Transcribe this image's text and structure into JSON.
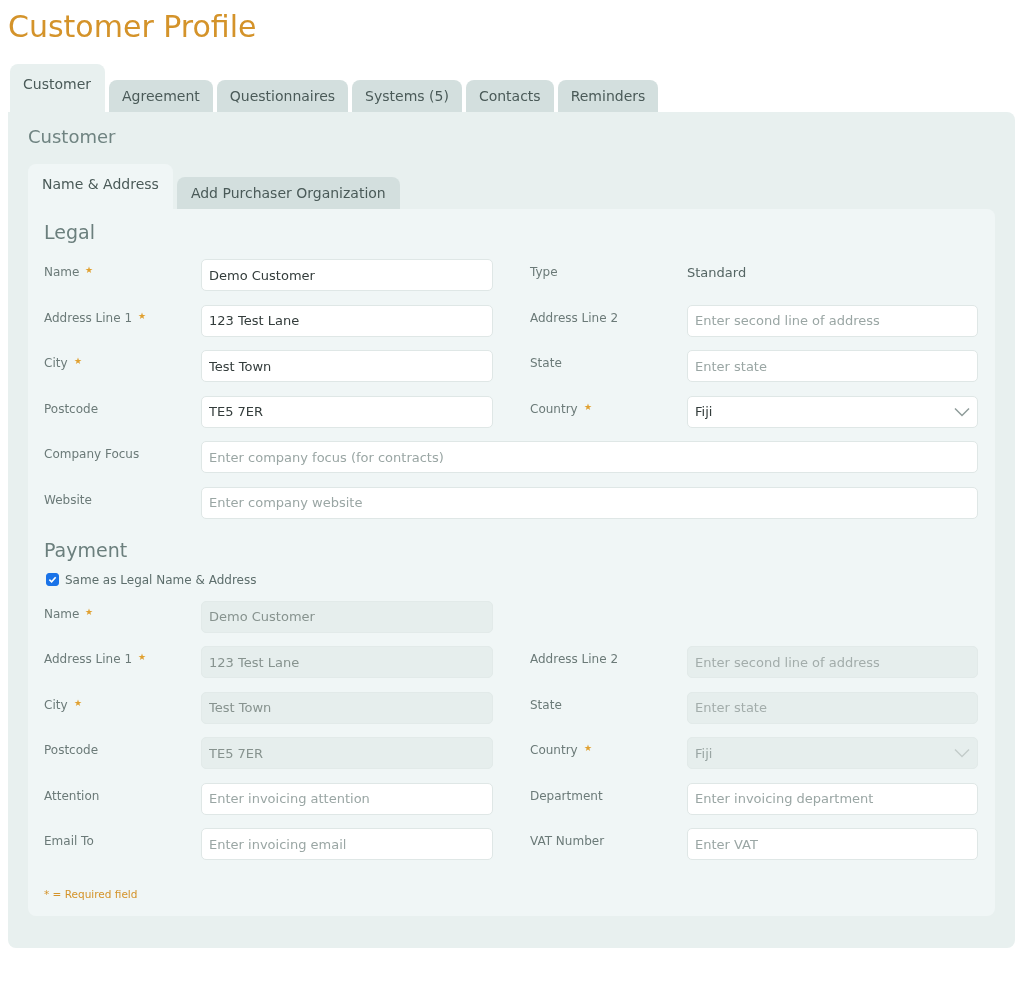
{
  "page_title": "Customer Profile",
  "tabs": [
    {
      "label": "Customer",
      "selected": true
    },
    {
      "label": "Agreement",
      "selected": false
    },
    {
      "label": "Questionnaires",
      "selected": false
    },
    {
      "label": "Systems (5)",
      "selected": false
    },
    {
      "label": "Contacts",
      "selected": false
    },
    {
      "label": "Reminders",
      "selected": false
    }
  ],
  "panel_title": "Customer",
  "subtabs": [
    {
      "label": "Name & Address",
      "selected": true
    },
    {
      "label": "Add Purchaser Organization",
      "selected": false
    }
  ],
  "sections": [
    {
      "title": "Legal",
      "rows": [
        [
          {
            "kind": "input",
            "label": "Name",
            "required": true,
            "value": "Demo Customer",
            "disabled": false
          },
          {
            "kind": "text",
            "label": "Type",
            "required": false,
            "value": "Standard"
          }
        ],
        [
          {
            "kind": "input",
            "label": "Address Line 1",
            "required": true,
            "value": "123 Test Lane",
            "disabled": false
          },
          {
            "kind": "input",
            "label": "Address Line 2",
            "required": false,
            "placeholder": "Enter second line of address",
            "disabled": false
          }
        ],
        [
          {
            "kind": "input",
            "label": "City",
            "required": true,
            "value": "Test Town",
            "disabled": false
          },
          {
            "kind": "input",
            "label": "State",
            "required": false,
            "placeholder": "Enter state",
            "disabled": false
          }
        ],
        [
          {
            "kind": "input",
            "label": "Postcode",
            "required": false,
            "value": "TE5 7ER",
            "disabled": false
          },
          {
            "kind": "select",
            "label": "Country",
            "required": true,
            "value": "Fiji",
            "disabled": false
          }
        ],
        [
          {
            "kind": "wide",
            "label": "Company Focus",
            "required": false,
            "placeholder": "Enter company focus (for contracts)",
            "disabled": false
          }
        ],
        [
          {
            "kind": "wide",
            "label": "Website",
            "required": false,
            "placeholder": "Enter company website",
            "disabled": false
          }
        ]
      ]
    },
    {
      "title": "Payment",
      "checkbox": {
        "label": "Same as Legal Name & Address",
        "checked": true
      },
      "rows": [
        [
          {
            "kind": "input",
            "label": "Name",
            "required": true,
            "value": "Demo Customer",
            "disabled": true
          }
        ],
        [
          {
            "kind": "input",
            "label": "Address Line 1",
            "required": true,
            "value": "123 Test Lane",
            "disabled": true
          },
          {
            "kind": "input",
            "label": "Address Line 2",
            "required": false,
            "placeholder": "Enter second line of address",
            "disabled": true
          }
        ],
        [
          {
            "kind": "input",
            "label": "City",
            "required": true,
            "value": "Test Town",
            "disabled": true
          },
          {
            "kind": "input",
            "label": "State",
            "required": false,
            "placeholder": "Enter state",
            "disabled": true
          }
        ],
        [
          {
            "kind": "input",
            "label": "Postcode",
            "required": false,
            "value": "TE5 7ER",
            "disabled": true
          },
          {
            "kind": "select",
            "label": "Country",
            "required": true,
            "value": "Fiji",
            "disabled": true
          }
        ],
        [
          {
            "kind": "input",
            "label": "Attention",
            "required": false,
            "placeholder": "Enter invoicing attention",
            "disabled": false
          },
          {
            "kind": "input",
            "label": "Department",
            "required": false,
            "placeholder": "Enter invoicing department",
            "disabled": false
          }
        ],
        [
          {
            "kind": "input",
            "label": "Email To",
            "required": false,
            "placeholder": "Enter invoicing email",
            "disabled": false
          },
          {
            "kind": "input",
            "label": "VAT Number",
            "required": false,
            "placeholder": "Enter VAT",
            "disabled": false
          }
        ]
      ]
    }
  ],
  "footnote": "* = Required field"
}
